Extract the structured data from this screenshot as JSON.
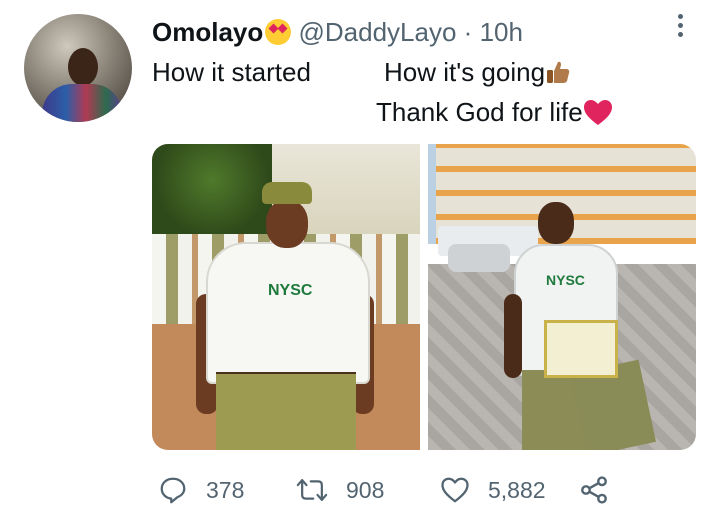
{
  "tweet": {
    "author_name": "Omolayo",
    "handle": "@DaddyLayo",
    "separator": "·",
    "time": "10h",
    "text_line1_left": "How it started",
    "text_line1_right": "How it's going",
    "text_line2": "Thank God for life",
    "image1_text": "NYSC",
    "image2_text": "NYSC"
  },
  "actions": {
    "replies": "378",
    "retweets": "908",
    "likes": "5,882"
  },
  "icons": [
    "more-options-icon",
    "reply-icon",
    "retweet-icon",
    "like-icon",
    "share-icon",
    "star-struck-emoji",
    "thumbs-up-emoji",
    "red-heart-emoji"
  ]
}
